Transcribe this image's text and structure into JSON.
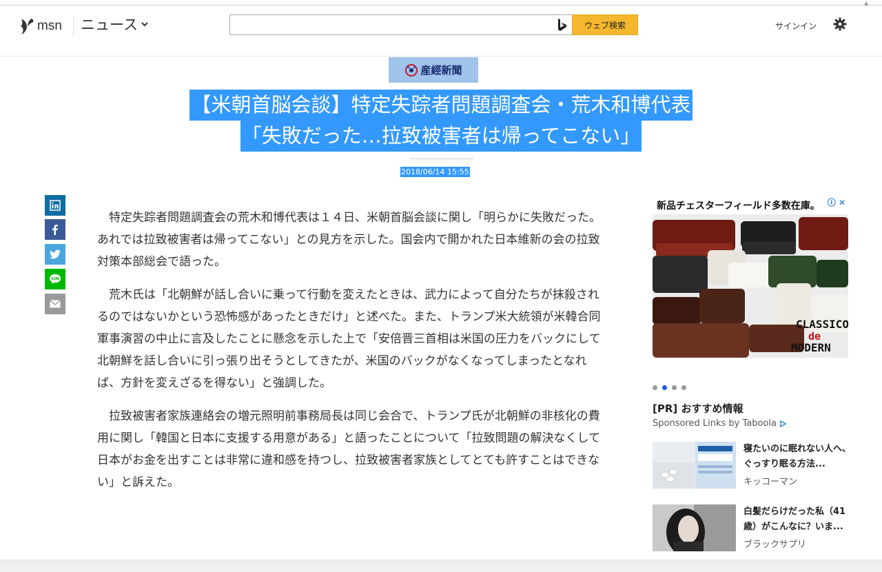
{
  "header": {
    "logo_text": "msn",
    "section_label": "ニュース",
    "search_placeholder": "",
    "search_button": "ウェブ検索",
    "signin": "サインイン"
  },
  "article": {
    "source": "産經新聞",
    "title_line1": "【米朝首脳会談】特定失踪者問題調査会・荒木和博代表",
    "title_line2": "「失敗だった…拉致被害者は帰ってこない」",
    "date": "2018/06/14 15:55",
    "paragraphs": [
      "特定失踪者問題調査会の荒木和博代表は１４日、米朝首脳会談に関し「明らかに失敗だった。あれでは拉致被害者は帰ってこない」との見方を示した。国会内で開かれた日本維新の会の拉致対策本部総会で語った。",
      "荒木氏は「北朝鮮が話し合いに乗って行動を変えたときは、武力によって自分たちが抹殺されるのではないかという恐怖感があったときだけ」と述べた。また、トランプ米大統領が米韓合同軍事演習の中止に言及したことに懸念を示した上で「安倍晋三首相は米国の圧力をバックにして北朝鮮を話し合いに引っ張り出そうとしてきたが、米国のバックがなくなってしまったとなれば、方針を変えざるを得ない」と強調した。",
      "拉致被害者家族連絡会の増元照明前事務局長は同じ会合で、トランプ氏が北朝鮮の非核化の費用に関し「韓国と日本に支援する用意がある」と語ったことについて「拉致問題の解決なくして日本がお金を出すことは非常に違和感を持つし、拉致被害者家族としてとても許すことはできない」と訴えた。"
    ]
  },
  "share": {
    "icons": [
      "linkedin-icon",
      "facebook-icon",
      "twitter-icon",
      "line-icon",
      "email-icon"
    ],
    "colors": {
      "linkedin": "#0e6da3",
      "facebook": "#3b5a98",
      "twitter": "#4aa5dc",
      "line": "#00b800",
      "email": "#999999"
    }
  },
  "ad": {
    "headline": "新品チェスターフィールド多数在庫。",
    "close": "ⓘ ✕",
    "image_text_1": "CLASSICO",
    "image_text_2": "de",
    "image_text_3": "MODERN"
  },
  "recommend": {
    "title": "[PR] おすすめ情報",
    "sponsored": "Sponsored Links by Taboola",
    "items": [
      {
        "title": "寝たいのに眠れない人へ、ぐっすり眠る方法...",
        "source": "キッコーマン"
      },
      {
        "title": "白髪だらけだった私（41歳）がこんなに？いま...",
        "source": "ブラックサプリ"
      }
    ]
  },
  "colors": {
    "accent": "#3399ff",
    "search_button": "#f5b72e",
    "source_bg": "#9fc3ea"
  }
}
